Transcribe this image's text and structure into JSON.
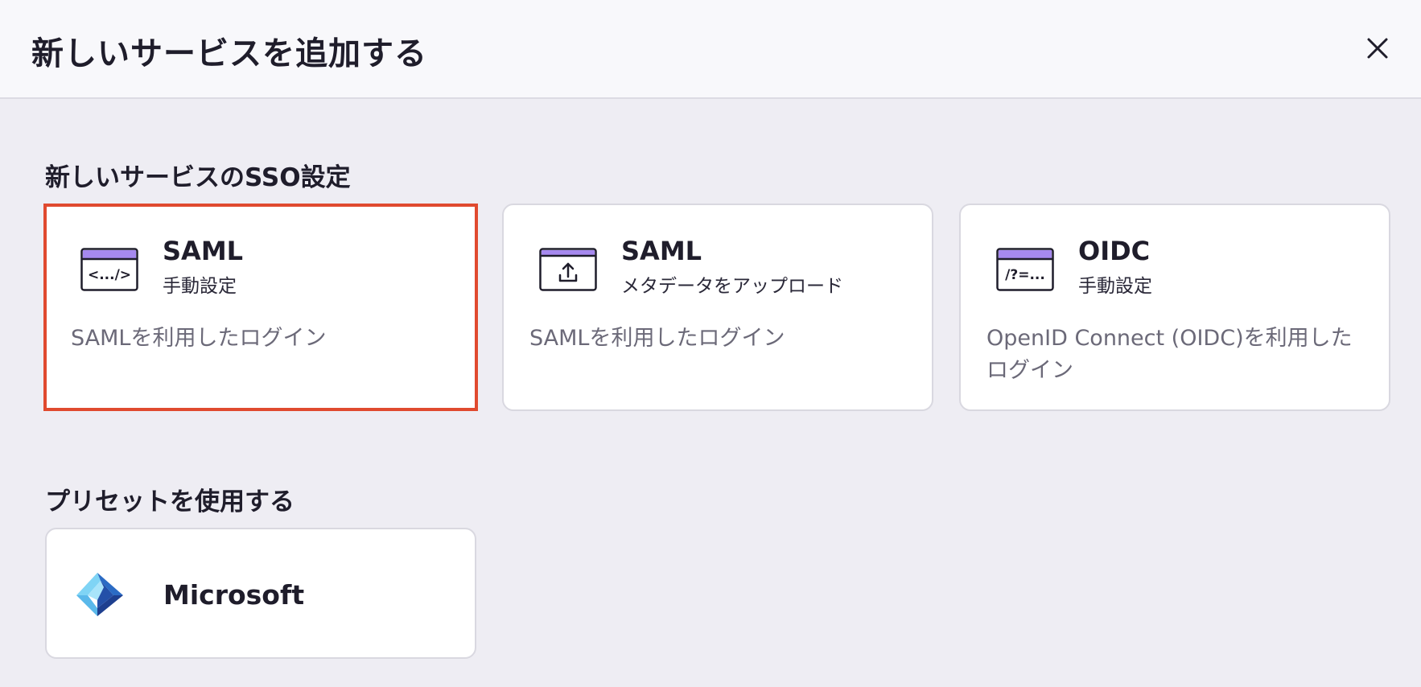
{
  "dialog": {
    "title": "新しいサービスを追加する",
    "close_icon": "close-icon"
  },
  "sso_section": {
    "title": "新しいサービスのSSO設定",
    "cards": [
      {
        "title": "SAML",
        "subtitle": "手動設定",
        "description": "SAMLを利用したログイン",
        "icon": "code-window-icon",
        "icon_text": "<.../>",
        "selected": true
      },
      {
        "title": "SAML",
        "subtitle": "メタデータをアップロード",
        "description": "SAMLを利用したログイン",
        "icon": "upload-window-icon",
        "selected": false
      },
      {
        "title": "OIDC",
        "subtitle": "手動設定",
        "description": "OpenID Connect (OIDC)を利用したログイン",
        "icon": "query-window-icon",
        "icon_text": "/?=...",
        "selected": false
      }
    ]
  },
  "preset_section": {
    "title": "プリセットを使用する",
    "presets": [
      {
        "label": "Microsoft",
        "icon": "microsoft-entra-logo-icon"
      }
    ]
  },
  "colors": {
    "selected_border": "#e04a2f",
    "icon_accent": "#a689ef",
    "page_background": "#eeedf3"
  }
}
